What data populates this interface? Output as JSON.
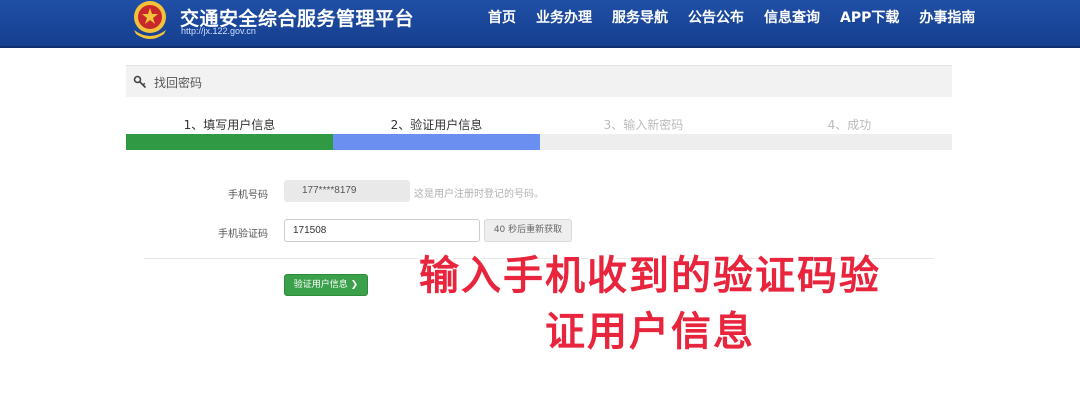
{
  "header": {
    "title": "交通安全综合服务管理平台",
    "url": "http://jx.122.gov.cn",
    "nav": [
      "首页",
      "业务办理",
      "服务导航",
      "公告公布",
      "信息查询",
      "APP下载",
      "办事指南"
    ]
  },
  "section": {
    "icon": "key-icon",
    "title": "找回密码"
  },
  "steps": [
    {
      "label": "1、填写用户信息",
      "state": "done",
      "color": "#2f9a43"
    },
    {
      "label": "2、验证用户信息",
      "state": "current",
      "color": "#6a8ff0"
    },
    {
      "label": "3、输入新密码",
      "state": "pending",
      "color": "#eeeeee"
    },
    {
      "label": "4、成功",
      "state": "pending",
      "color": "#eeeeee"
    }
  ],
  "form": {
    "phone_label": "手机号码",
    "phone_value": "177****8179",
    "phone_hint": "这是用户注册时登记的号码。",
    "code_label": "手机验证码",
    "code_value": "171508",
    "resend_label": "40 秒后重新获取",
    "verify_label": "验证用户信息 ❯"
  },
  "overlay": {
    "line1": "输入手机收到的验证码验",
    "line2": "证用户信息",
    "color": "#e8253c"
  }
}
